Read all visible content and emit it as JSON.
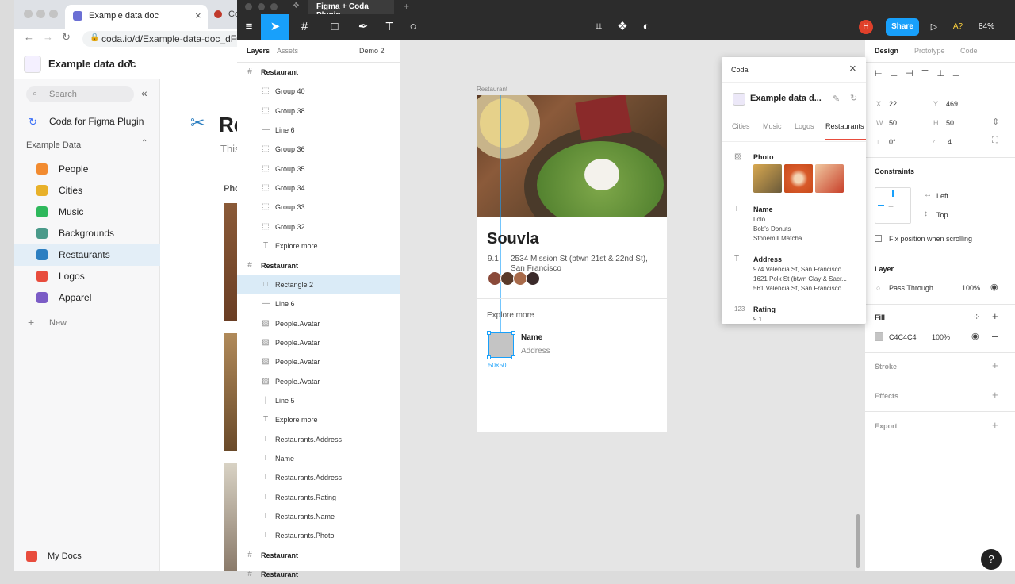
{
  "browser": {
    "tab1_title": "Example data doc",
    "tab2_title": "Co",
    "url": "coda.io/d/Example-data-doc_dFO"
  },
  "coda": {
    "doc_title": "Example data doc",
    "search_placeholder": "Search",
    "plugin_page": "Coda for Figma Plugin",
    "section": "Example Data",
    "items": [
      {
        "label": "People",
        "color": "#f28b30"
      },
      {
        "label": "Cities",
        "color": "#e8b12a"
      },
      {
        "label": "Music",
        "color": "#2eb85c"
      },
      {
        "label": "Backgrounds",
        "color": "#4a9a8a"
      },
      {
        "label": "Restaurants",
        "color": "#2d7fc1"
      },
      {
        "label": "Logos",
        "color": "#e84c3d"
      },
      {
        "label": "Apparel",
        "color": "#7b5cc6"
      }
    ],
    "new_label": "New",
    "my_docs": "My Docs",
    "page_title_partial": "Re",
    "subtitle_partial": "This",
    "col_partial": "Pho"
  },
  "figma": {
    "file_title": "Figma + Coda Plugin",
    "share": "Share",
    "zoom": "84%",
    "avatar": "H",
    "tabs": {
      "layers": "Layers",
      "assets": "Assets",
      "page": "Demo 2"
    },
    "layers": [
      {
        "label": "Restaurant",
        "kind": "frame",
        "indent": 0
      },
      {
        "label": "Group 40",
        "kind": "group",
        "indent": 1
      },
      {
        "label": "Group 38",
        "kind": "group",
        "indent": 1
      },
      {
        "label": "Line 6",
        "kind": "line",
        "indent": 1
      },
      {
        "label": "Group 36",
        "kind": "group",
        "indent": 1
      },
      {
        "label": "Group 35",
        "kind": "group",
        "indent": 1
      },
      {
        "label": "Group 34",
        "kind": "group",
        "indent": 1
      },
      {
        "label": "Group 33",
        "kind": "group",
        "indent": 1
      },
      {
        "label": "Group 32",
        "kind": "group",
        "indent": 1
      },
      {
        "label": "Explore more",
        "kind": "text",
        "indent": 1
      },
      {
        "label": "Restaurant",
        "kind": "frame",
        "indent": 0
      },
      {
        "label": "Rectangle 2",
        "kind": "rect",
        "indent": 1,
        "selected": true
      },
      {
        "label": "Line 6",
        "kind": "line",
        "indent": 1
      },
      {
        "label": "People.Avatar",
        "kind": "image",
        "indent": 1
      },
      {
        "label": "People.Avatar",
        "kind": "image",
        "indent": 1
      },
      {
        "label": "People.Avatar",
        "kind": "image",
        "indent": 1
      },
      {
        "label": "People.Avatar",
        "kind": "image",
        "indent": 1
      },
      {
        "label": "Line 5",
        "kind": "vline",
        "indent": 1
      },
      {
        "label": "Explore more",
        "kind": "text",
        "indent": 1
      },
      {
        "label": "Restaurants.Address",
        "kind": "text",
        "indent": 1
      },
      {
        "label": "Name",
        "kind": "text",
        "indent": 1
      },
      {
        "label": "Restaurants.Address",
        "kind": "text",
        "indent": 1
      },
      {
        "label": "Restaurants.Rating",
        "kind": "text",
        "indent": 1
      },
      {
        "label": "Restaurants.Name",
        "kind": "text",
        "indent": 1
      },
      {
        "label": "Restaurants.Photo",
        "kind": "text",
        "indent": 1
      },
      {
        "label": "Restaurant",
        "kind": "frame",
        "indent": 0
      },
      {
        "label": "Restaurant",
        "kind": "frame",
        "indent": 0
      }
    ],
    "canvas": {
      "frame_label": "Restaurant",
      "name": "Souvla",
      "rating": "9.1",
      "address": "2534 Mission St (btwn 21st & 22nd St), San Francisco",
      "explore": "Explore more",
      "card_name": "Name",
      "card_address": "Address",
      "size_badge": "50×50"
    },
    "design": {
      "tabs": [
        "Design",
        "Prototype",
        "Code"
      ],
      "x_label": "X",
      "x": "22",
      "y_label": "Y",
      "y": "469",
      "w_label": "W",
      "w": "50",
      "h_label": "H",
      "h": "50",
      "rotation": "0°",
      "radius": "4",
      "constraints": "Constraints",
      "c_h": "Left",
      "c_v": "Top",
      "fix_scroll": "Fix position when scrolling",
      "layer": "Layer",
      "blend": "Pass Through",
      "opacity": "100%",
      "fill": "Fill",
      "fill_hex": "C4C4C4",
      "fill_opacity": "100%",
      "fill_color": "#c4c4c4",
      "stroke": "Stroke",
      "effects": "Effects",
      "export": "Export"
    }
  },
  "plugin": {
    "title": "Coda",
    "doc": "Example data d...",
    "tabs": [
      "Cities",
      "Music",
      "Logos",
      "Restaurants"
    ],
    "fields": [
      {
        "icon": "image-icon",
        "name": "Photo",
        "values": []
      },
      {
        "icon": "text-icon",
        "name": "Name",
        "values": [
          "Lolo",
          "Bob's Donuts",
          "Stonemill Matcha"
        ]
      },
      {
        "icon": "text-icon",
        "name": "Address",
        "values": [
          "974 Valencia St, San Francisco",
          "1621 Polk St (btwn Clay & Sacr...",
          "561 Valencia St, San Francisco"
        ]
      },
      {
        "icon": "number-icon",
        "name": "Rating",
        "values": [
          "9.1"
        ]
      }
    ]
  }
}
